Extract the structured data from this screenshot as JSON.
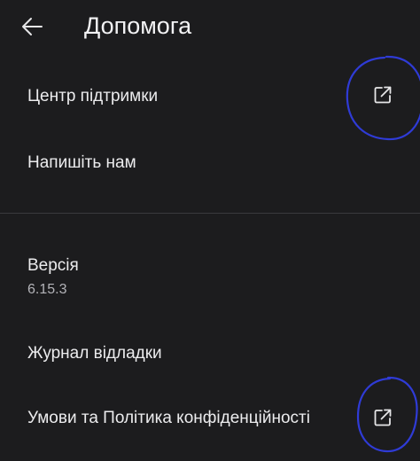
{
  "header": {
    "title": "Допомога",
    "back_icon": "arrow-left-icon"
  },
  "help_items": [
    {
      "label": "Центр підтримки",
      "icon": "external-link-icon"
    },
    {
      "label": "Напишіть нам"
    }
  ],
  "about_items": {
    "version": {
      "label": "Версія",
      "value": "6.15.3"
    },
    "debug_log": {
      "label": "Журнал відладки"
    },
    "terms": {
      "label": "Умови та Політика конфіденційності",
      "icon": "external-link-icon"
    }
  },
  "colors": {
    "background": "#1c1c1e",
    "text": "#ececee",
    "secondary_text": "#b3b3b8",
    "divider": "#3a3a3e",
    "annotation": "#2f3bd6"
  }
}
